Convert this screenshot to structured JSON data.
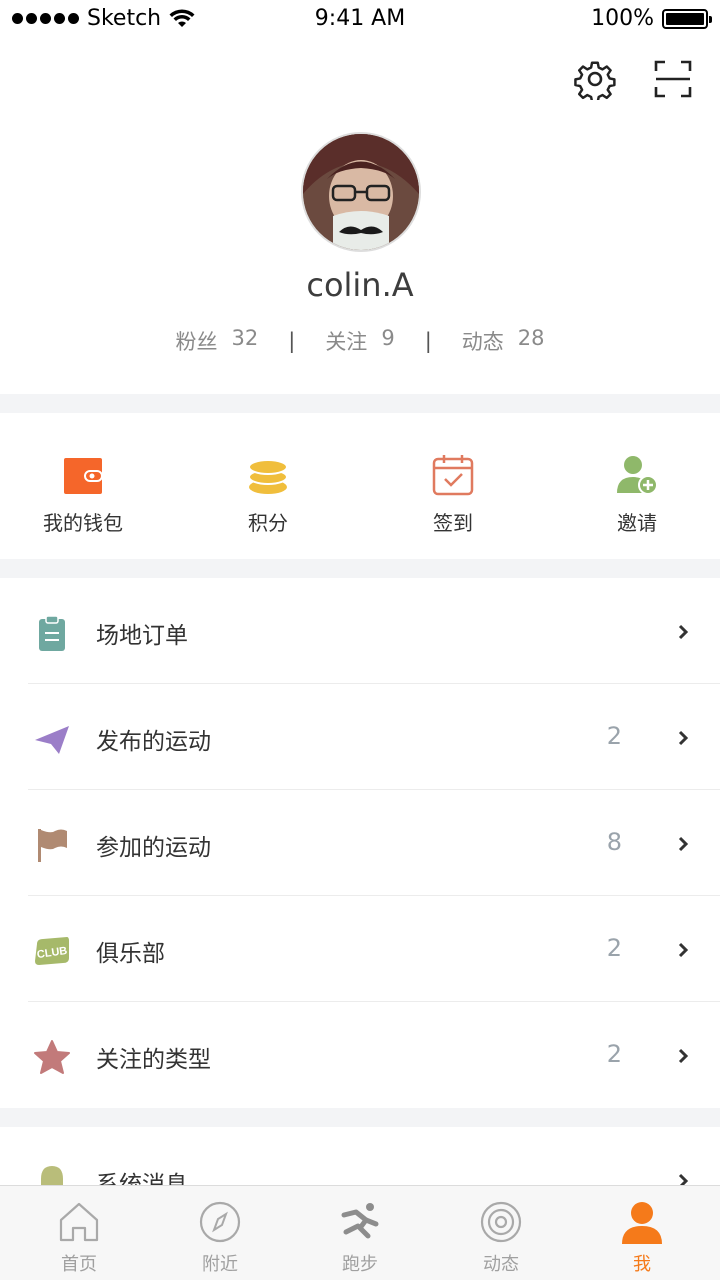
{
  "status_bar": {
    "carrier": "Sketch",
    "time": "9:41 AM",
    "battery": "100%"
  },
  "profile": {
    "username": "colin.A",
    "stats": [
      {
        "label": "粉丝",
        "value": "32"
      },
      {
        "label": "关注",
        "value": "9"
      },
      {
        "label": "动态",
        "value": "28"
      }
    ]
  },
  "quick_actions": [
    {
      "label": "我的钱包",
      "icon": "wallet-icon",
      "color": "#f5662a"
    },
    {
      "label": "积分",
      "icon": "coins-icon",
      "color": "#f0be3c"
    },
    {
      "label": "签到",
      "icon": "calendar-check-icon",
      "color": "#e07a5f"
    },
    {
      "label": "邀请",
      "icon": "add-user-icon",
      "color": "#8fb86a"
    }
  ],
  "menu": [
    {
      "label": "场地订单",
      "count": "",
      "icon": "clipboard-icon",
      "color": "#6fa8a0"
    },
    {
      "label": "发布的运动",
      "count": "2",
      "icon": "paper-plane-icon",
      "color": "#9b7ec8"
    },
    {
      "label": "参加的运动",
      "count": "8",
      "icon": "flag-icon",
      "color": "#b08a72"
    },
    {
      "label": "俱乐部",
      "count": "2",
      "icon": "club-icon",
      "color": "#a6b96a"
    },
    {
      "label": "关注的类型",
      "count": "2",
      "icon": "star-icon",
      "color": "#c27a7a"
    }
  ],
  "message_item": {
    "label": "系统消息",
    "icon": "bell-icon",
    "color": "#b9bd7a"
  },
  "tabbar": [
    {
      "label": "首页",
      "icon": "home-icon",
      "active": false
    },
    {
      "label": "附近",
      "icon": "compass-icon",
      "active": false
    },
    {
      "label": "跑步",
      "icon": "running-icon",
      "active": false
    },
    {
      "label": "动态",
      "icon": "activity-icon",
      "active": false
    },
    {
      "label": "我",
      "icon": "user-icon",
      "active": true
    }
  ],
  "colors": {
    "accent": "#f57a1a",
    "band": "#f3f4f6",
    "count_text": "#9aa3ab"
  }
}
